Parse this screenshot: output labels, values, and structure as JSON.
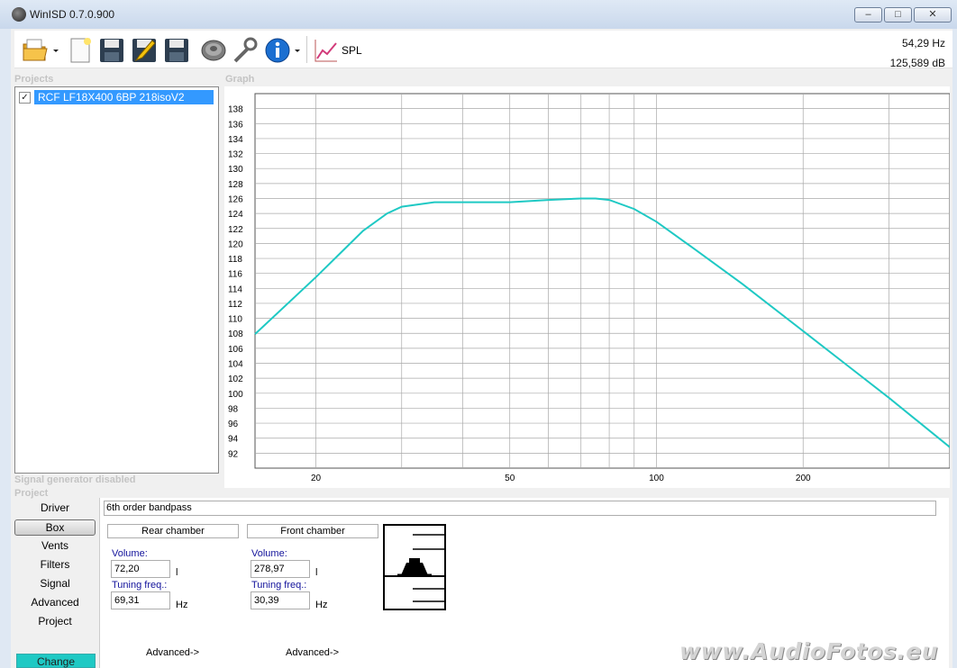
{
  "window": {
    "title": "WinISD 0.7.0.900",
    "minimize": "–",
    "maximize": "□",
    "close": "✕"
  },
  "toolbar": {
    "icons": [
      "open-folder-icon",
      "new-document-icon",
      "save-icon",
      "save-as-icon",
      "save-all-icon",
      "driver-icon",
      "tools-icon",
      "info-icon",
      "spl-graph-icon"
    ],
    "spl_label": "SPL",
    "freq_readout": "54,29 Hz",
    "spl_readout": "125,589 dB"
  },
  "captions": {
    "projects": "Projects",
    "graph": "Graph",
    "signal_generator": "Signal generator disabled",
    "project": "Project"
  },
  "projects": {
    "items": [
      {
        "label": "RCF LF18X400 6BP 218isoV2",
        "checked": "✓"
      }
    ]
  },
  "nav": {
    "items": [
      "Driver",
      "Box",
      "Vents",
      "Filters",
      "Signal",
      "Advanced",
      "Project"
    ],
    "active": "Box",
    "change_button": "Change"
  },
  "box": {
    "type": "6th order bandpass",
    "rear": {
      "title": "Rear chamber",
      "volume_label": "Volume:",
      "volume": "72,20",
      "volume_unit": "l",
      "tuning_label": "Tuning freq.:",
      "tuning": "69,31",
      "tuning_unit": "Hz",
      "advanced": "Advanced->"
    },
    "front": {
      "title": "Front chamber",
      "volume_label": "Volume:",
      "volume": "278,97",
      "volume_unit": "l",
      "tuning_label": "Tuning freq.:",
      "tuning": "30,39",
      "tuning_unit": "Hz",
      "advanced": "Advanced->"
    }
  },
  "watermark": "www.AudioFotos.eu",
  "chart_data": {
    "type": "line",
    "xscale": "log",
    "xlim": [
      15,
      400
    ],
    "ylim": [
      90,
      140
    ],
    "xticks": [
      20,
      50,
      100,
      200
    ],
    "yticks": [
      92,
      94,
      96,
      98,
      100,
      102,
      104,
      106,
      108,
      110,
      112,
      114,
      116,
      118,
      120,
      122,
      124,
      126,
      128,
      130,
      132,
      134,
      136,
      138
    ],
    "grid": true,
    "color": "#1fc9c4",
    "series": [
      {
        "x": [
          15,
          20,
          25,
          28,
          30,
          35,
          40,
          50,
          60,
          70,
          75,
          80,
          90,
          100,
          120,
          150,
          200,
          250,
          300,
          400
        ],
        "y": [
          107.9,
          115.5,
          121.7,
          124.0,
          124.9,
          125.5,
          125.5,
          125.5,
          125.8,
          126.0,
          126.0,
          125.8,
          124.6,
          122.9,
          119.2,
          114.6,
          108.3,
          103.4,
          99.4,
          92.8
        ]
      }
    ]
  }
}
